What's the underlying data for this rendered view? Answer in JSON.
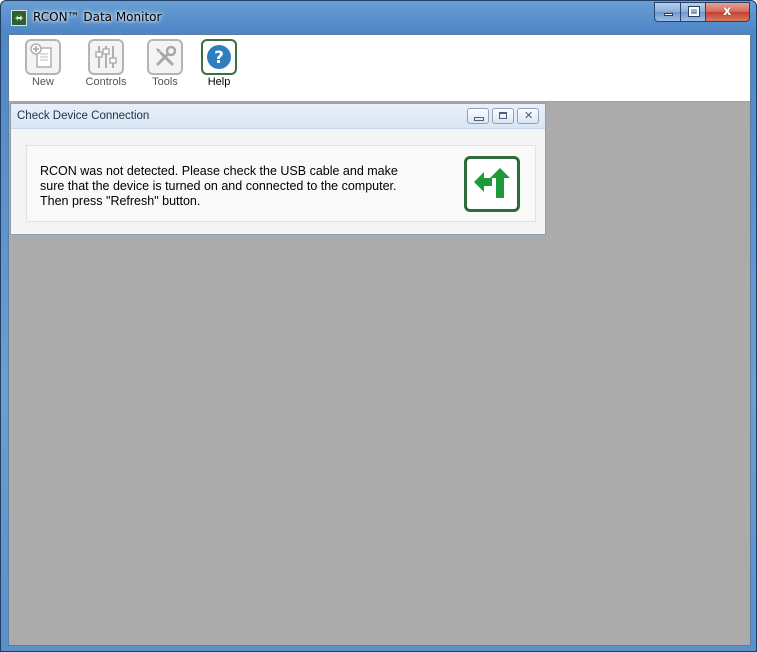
{
  "window": {
    "title": "RCON™ Data Monitor",
    "buttons": {
      "minimize": "minimize",
      "maximize": "maximize",
      "close": "close"
    }
  },
  "toolbar": {
    "items": [
      {
        "label": "New",
        "icon": "new-document-icon",
        "active": false
      },
      {
        "label": "Controls",
        "icon": "sliders-icon",
        "active": false
      },
      {
        "label": "Tools",
        "icon": "tools-icon",
        "active": false
      },
      {
        "label": "Help",
        "icon": "help-icon",
        "active": true
      }
    ]
  },
  "child_window": {
    "title": "Check Device Connection",
    "message": "RCON was not detected. Please check the USB cable and make sure that the device is turned on and connected to the computer. Then press \"Refresh\" button.",
    "refresh_icon": "refresh-icon"
  },
  "colors": {
    "mdi_background": "#ababab",
    "accent_green": "#2e6b3a",
    "help_blue": "#2f7fbf"
  }
}
